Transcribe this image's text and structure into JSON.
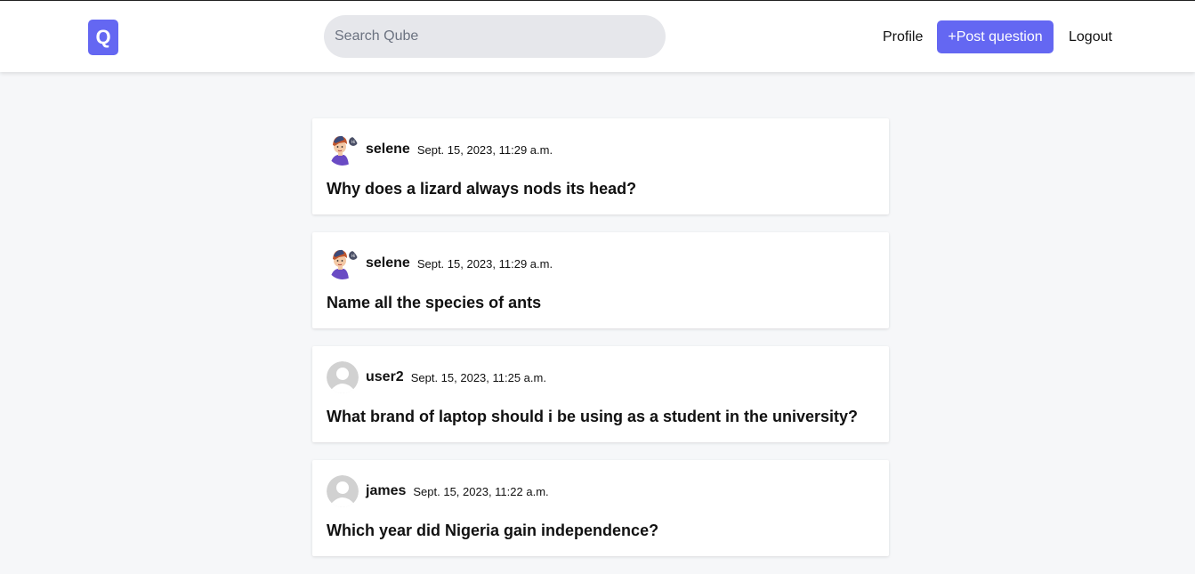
{
  "header": {
    "logo_text": "Q",
    "search": {
      "placeholder": "Search Qube",
      "value": ""
    },
    "profile_label": "Profile",
    "post_label": "+Post question",
    "logout_label": "Logout"
  },
  "colors": {
    "accent": "#6467f2",
    "page_background": "#f6f7f9",
    "search_background": "#e6e7eb"
  },
  "questions": [
    {
      "username": "selene",
      "timestamp": "Sept. 15, 2023, 11:29 a.m.",
      "text": "Why does a lizard always nods its head?",
      "avatar": "cartoon-avatar-icon"
    },
    {
      "username": "selene",
      "timestamp": "Sept. 15, 2023, 11:29 a.m.",
      "text": "Name all the species of ants",
      "avatar": "cartoon-avatar-icon"
    },
    {
      "username": "user2",
      "timestamp": "Sept. 15, 2023, 11:25 a.m.",
      "text": "What brand of laptop should i be using as a student in the university?",
      "avatar": "default-avatar-icon"
    },
    {
      "username": "james",
      "timestamp": "Sept. 15, 2023, 11:22 a.m.",
      "text": "Which year did Nigeria gain independence?",
      "avatar": "default-avatar-icon"
    }
  ]
}
